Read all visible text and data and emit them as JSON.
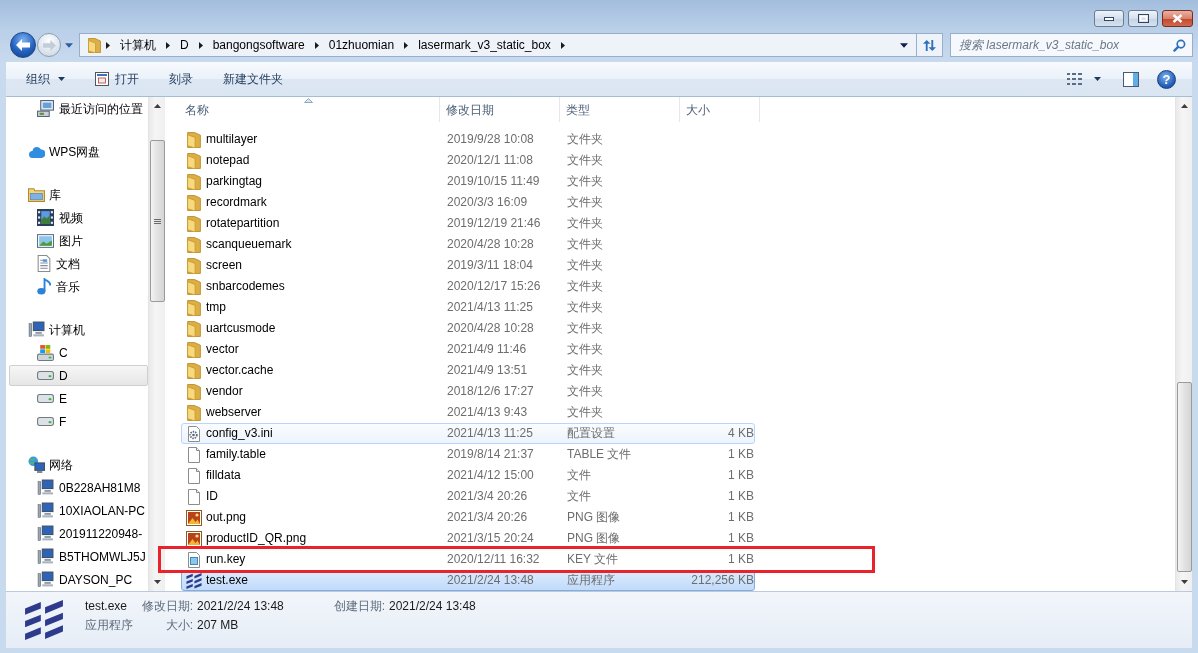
{
  "address_bar": {
    "crumbs": [
      "计算机",
      "D",
      "bangongsoftware",
      "01zhuomian",
      "lasermark_v3_static_box"
    ]
  },
  "search": {
    "placeholder": "搜索 lasermark_v3_static_box"
  },
  "toolbar": {
    "items": [
      {
        "label": "组织",
        "kind": "menu"
      },
      {
        "label": "打开",
        "kind": "open"
      },
      {
        "label": "刻录",
        "kind": "plain"
      },
      {
        "label": "新建文件夹",
        "kind": "plain"
      }
    ],
    "help": {
      "label": "?"
    }
  },
  "sidebar": {
    "groups": [
      {
        "children": [
          {
            "label": "最近访问的位置",
            "kind": "recent",
            "selected": false
          }
        ]
      },
      {
        "label": "WPS网盘",
        "kind": "cloud",
        "selected": false
      },
      {
        "label": "库",
        "kind": "library",
        "selected": false,
        "children": [
          {
            "label": "视频",
            "kind": "video",
            "selected": false
          },
          {
            "label": "图片",
            "kind": "picture",
            "selected": false
          },
          {
            "label": "文档",
            "kind": "document",
            "selected": false
          },
          {
            "label": "音乐",
            "kind": "music",
            "selected": false
          }
        ]
      },
      {
        "label": "计算机",
        "kind": "computer",
        "selected": false,
        "children": [
          {
            "label": "C",
            "kind": "system-drive",
            "selected": false
          },
          {
            "label": "D",
            "kind": "drive",
            "selected": true
          },
          {
            "label": "E",
            "kind": "drive",
            "selected": false
          },
          {
            "label": "F",
            "kind": "drive",
            "selected": false
          }
        ]
      },
      {
        "label": "网络",
        "kind": "network",
        "selected": false,
        "children": [
          {
            "label": "0B228AH81M8",
            "kind": "pc",
            "selected": false
          },
          {
            "label": "10XIAOLAN-PC",
            "kind": "pc",
            "selected": false
          },
          {
            "label": "201911220948-",
            "kind": "pc",
            "selected": false
          },
          {
            "label": "B5THOMWLJ5J",
            "kind": "pc",
            "selected": false
          },
          {
            "label": "DAYSON_PC",
            "kind": "pc",
            "selected": false
          }
        ]
      }
    ]
  },
  "file_list": {
    "columns": [
      {
        "label": "名称",
        "sorted": true
      },
      {
        "label": "修改日期",
        "sorted": false
      },
      {
        "label": "类型",
        "sorted": false
      },
      {
        "label": "大小",
        "sorted": false
      }
    ],
    "rows": [
      {
        "kind": "folder",
        "name": "multilayer",
        "date": "2019/9/28 10:08",
        "type": "文件夹",
        "selected": false,
        "hovered": false,
        "annotated": false
      },
      {
        "kind": "folder",
        "name": "notepad",
        "date": "2020/12/1 11:08",
        "type": "文件夹",
        "selected": false,
        "hovered": false,
        "annotated": false
      },
      {
        "kind": "folder",
        "name": "parkingtag",
        "date": "2019/10/15 11:49",
        "type": "文件夹",
        "selected": false,
        "hovered": false,
        "annotated": false
      },
      {
        "kind": "folder",
        "name": "recordmark",
        "date": "2020/3/3 16:09",
        "type": "文件夹",
        "selected": false,
        "hovered": false,
        "annotated": false
      },
      {
        "kind": "folder",
        "name": "rotatepartition",
        "date": "2019/12/19 21:46",
        "type": "文件夹",
        "selected": false,
        "hovered": false,
        "annotated": false
      },
      {
        "kind": "folder",
        "name": "scanqueuemark",
        "date": "2020/4/28 10:28",
        "type": "文件夹",
        "selected": false,
        "hovered": false,
        "annotated": false
      },
      {
        "kind": "folder",
        "name": "screen",
        "date": "2019/3/11 18:04",
        "type": "文件夹",
        "selected": false,
        "hovered": false,
        "annotated": false
      },
      {
        "kind": "folder",
        "name": "snbarcodemes",
        "date": "2020/12/17 15:26",
        "type": "文件夹",
        "selected": false,
        "hovered": false,
        "annotated": false
      },
      {
        "kind": "folder",
        "name": "tmp",
        "date": "2021/4/13 11:25",
        "type": "文件夹",
        "selected": false,
        "hovered": false,
        "annotated": false
      },
      {
        "kind": "folder",
        "name": "uartcusmode",
        "date": "2020/4/28 10:28",
        "type": "文件夹",
        "selected": false,
        "hovered": false,
        "annotated": false
      },
      {
        "kind": "folder",
        "name": "vector",
        "date": "2021/4/9 11:46",
        "type": "文件夹",
        "selected": false,
        "hovered": false,
        "annotated": false
      },
      {
        "kind": "folder",
        "name": "vector.cache",
        "date": "2021/4/9 13:51",
        "type": "文件夹",
        "selected": false,
        "hovered": false,
        "annotated": false
      },
      {
        "kind": "folder",
        "name": "vendor",
        "date": "2018/12/6 17:27",
        "type": "文件夹",
        "selected": false,
        "hovered": false,
        "annotated": false
      },
      {
        "kind": "folder",
        "name": "webserver",
        "date": "2021/4/13 9:43",
        "type": "文件夹",
        "selected": false,
        "hovered": false,
        "annotated": false
      },
      {
        "kind": "settings",
        "name": "config_v3.ini",
        "date": "2021/4/13 11:25",
        "type": "配置设置",
        "size": "4 KB",
        "selected": false,
        "hovered": true,
        "annotated": false
      },
      {
        "kind": "file",
        "name": "family.table",
        "date": "2019/8/14 21:37",
        "type": "TABLE 文件",
        "size": "1 KB",
        "selected": false,
        "hovered": false,
        "annotated": false
      },
      {
        "kind": "file",
        "name": "filldata",
        "date": "2021/4/12 15:00",
        "type": "文件",
        "size": "1 KB",
        "selected": false,
        "hovered": false,
        "annotated": false
      },
      {
        "kind": "file",
        "name": "ID",
        "date": "2021/3/4 20:26",
        "type": "文件",
        "size": "1 KB",
        "selected": false,
        "hovered": false,
        "annotated": false
      },
      {
        "kind": "image",
        "name": "out.png",
        "date": "2021/3/4 20:26",
        "type": "PNG 图像",
        "size": "1 KB",
        "selected": false,
        "hovered": false,
        "annotated": false
      },
      {
        "kind": "image",
        "name": "productID_QR.png",
        "date": "2021/3/15 20:24",
        "type": "PNG 图像",
        "size": "1 KB",
        "selected": false,
        "hovered": false,
        "annotated": false
      },
      {
        "kind": "key",
        "name": "run.key",
        "date": "2020/12/11 16:32",
        "type": "KEY 文件",
        "size": "1 KB",
        "selected": false,
        "hovered": false,
        "annotated": true
      },
      {
        "kind": "app",
        "name": "test.exe",
        "date": "2021/2/24 13:48",
        "type": "应用程序",
        "size": "212,256 KB",
        "selected": true,
        "hovered": false,
        "annotated": false
      }
    ]
  },
  "details": {
    "kind": "app",
    "name": "test.exe",
    "type": "应用程序",
    "fields": [
      {
        "label": "修改日期:",
        "value": "2021/2/24 13:48"
      },
      {
        "label": "创建日期:",
        "value": "2021/2/24 13:48"
      },
      {
        "label": "大小:",
        "value": "207 MB"
      }
    ]
  }
}
